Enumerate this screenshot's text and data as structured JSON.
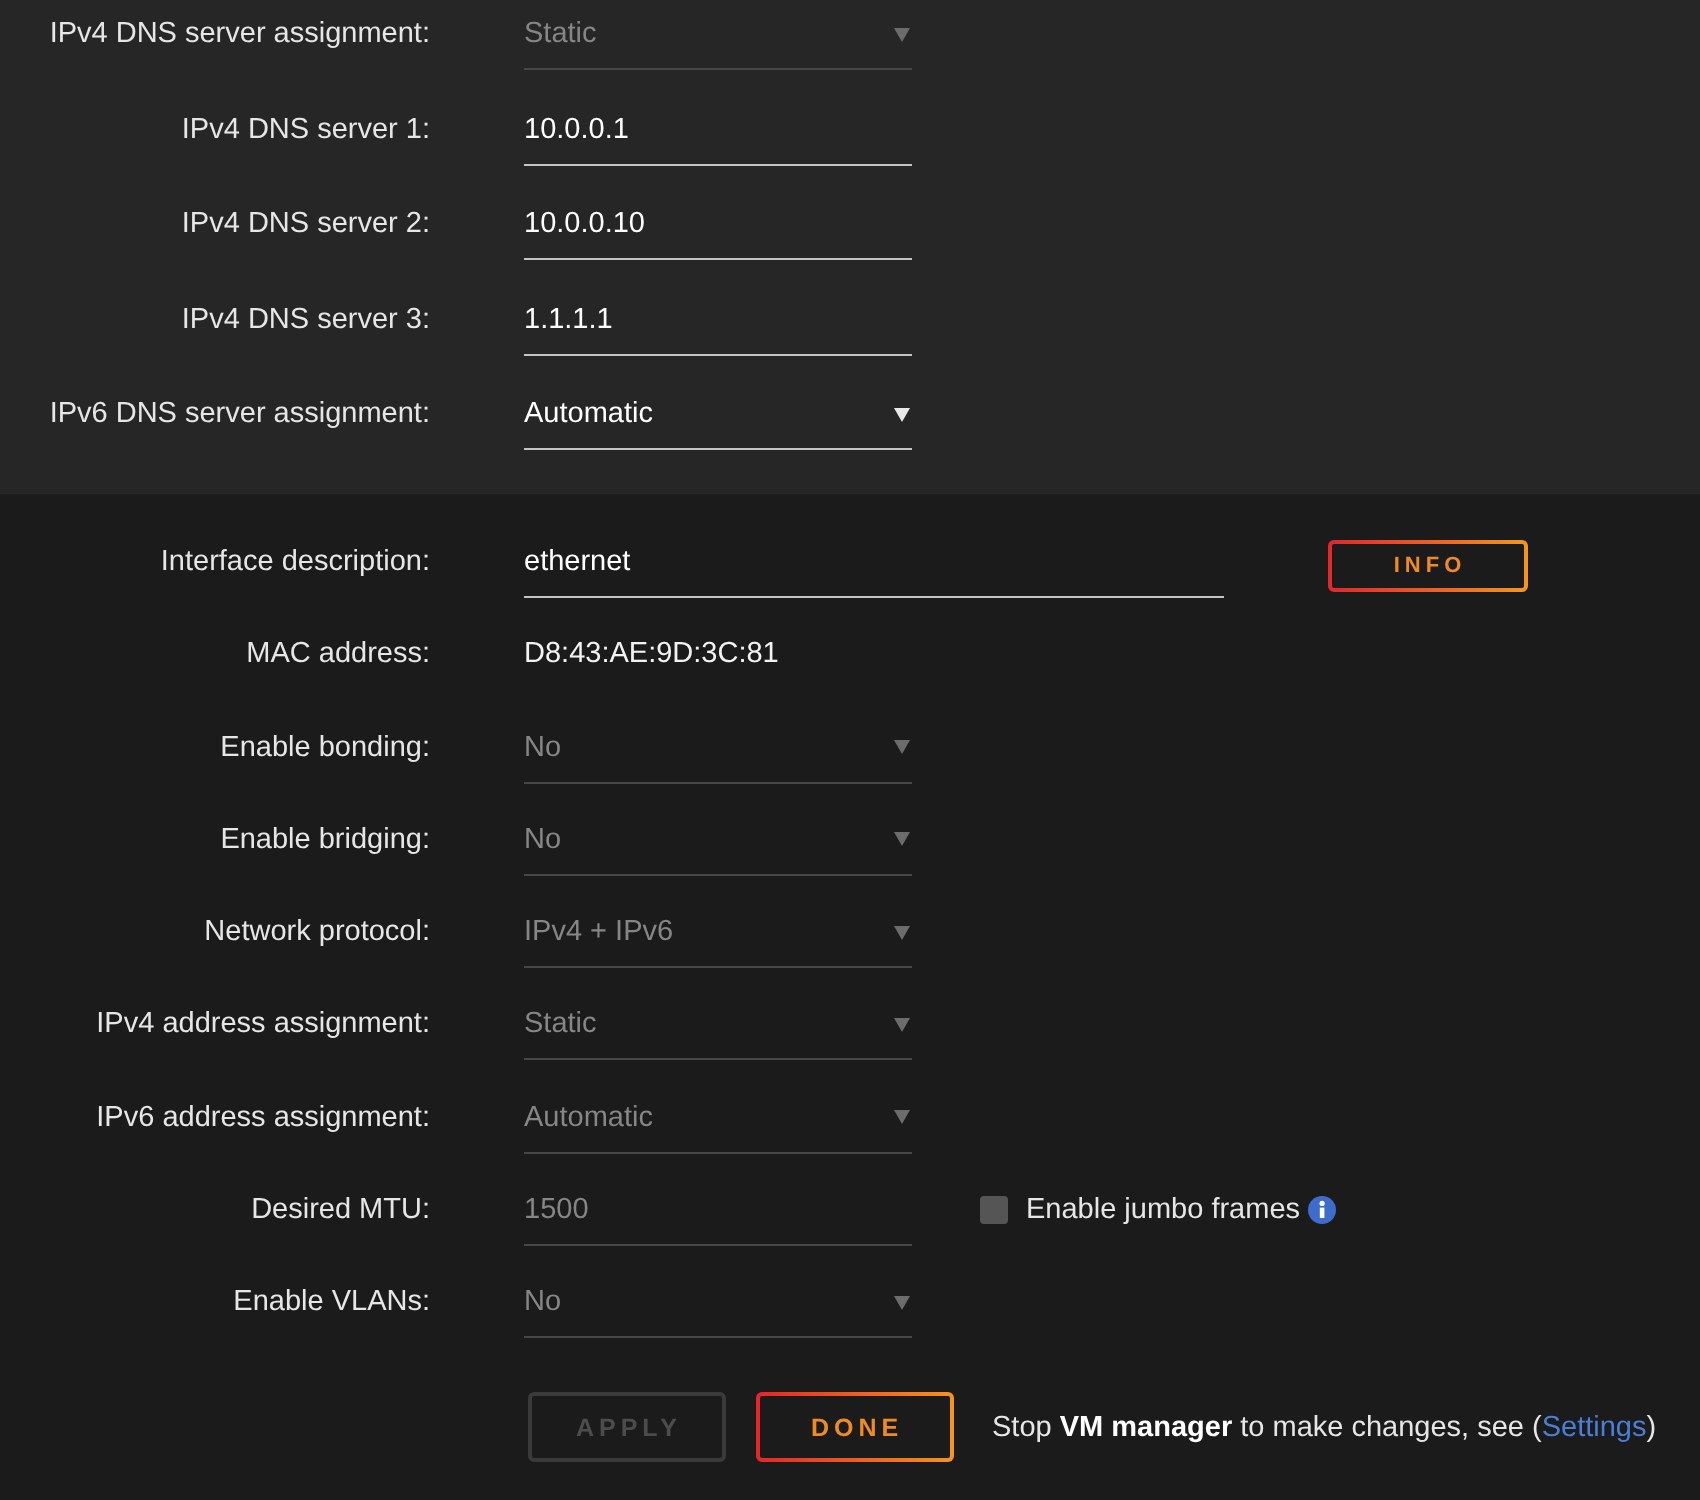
{
  "dns_section": {
    "fields": [
      {
        "kind": "select",
        "label": "IPv4 DNS server assignment:",
        "value": "Static",
        "disabled": true
      },
      {
        "kind": "input",
        "label": "IPv4 DNS server 1:",
        "value": "10.0.0.1",
        "disabled": false
      },
      {
        "kind": "input",
        "label": "IPv4 DNS server 2:",
        "value": "10.0.0.10",
        "disabled": false
      },
      {
        "kind": "input",
        "label": "IPv4 DNS server 3:",
        "value": "1.1.1.1",
        "disabled": false
      },
      {
        "kind": "select",
        "label": "IPv6 DNS server assignment:",
        "value": "Automatic",
        "disabled": false
      }
    ]
  },
  "interface_section": {
    "fields": [
      {
        "kind": "input",
        "label": "Interface description:",
        "value": "ethernet",
        "disabled": false,
        "button": {
          "label": "INFO",
          "disabled": false
        }
      },
      {
        "kind": "text",
        "label": "MAC address:",
        "value": "D8:43:AE:9D:3C:81"
      },
      {
        "kind": "select",
        "label": "Enable bonding:",
        "value": "No",
        "disabled": true
      },
      {
        "kind": "select",
        "label": "Enable bridging:",
        "value": "No",
        "disabled": true
      },
      {
        "kind": "select",
        "label": "Network protocol:",
        "value": "IPv4 + IPv6",
        "disabled": true
      },
      {
        "kind": "select",
        "label": "IPv4 address assignment:",
        "value": "Static",
        "disabled": true
      },
      {
        "kind": "select",
        "label": "IPv6 address assignment:",
        "value": "Automatic",
        "disabled": true
      },
      {
        "kind": "input",
        "label": "Desired MTU:",
        "value": "1500",
        "disabled": true,
        "checkbox": {
          "label": "Enable jumbo frames",
          "checked": false
        }
      },
      {
        "kind": "select",
        "label": "Enable VLANs:",
        "value": "No",
        "disabled": true
      }
    ]
  },
  "footer": {
    "buttons": [
      {
        "label": "APPLY",
        "disabled": true
      },
      {
        "label": "DONE",
        "disabled": false
      }
    ],
    "message": {
      "text": "Stop **VM manager** to make changes, see (",
      "link": "Settings",
      "text_after": ")"
    }
  }
}
